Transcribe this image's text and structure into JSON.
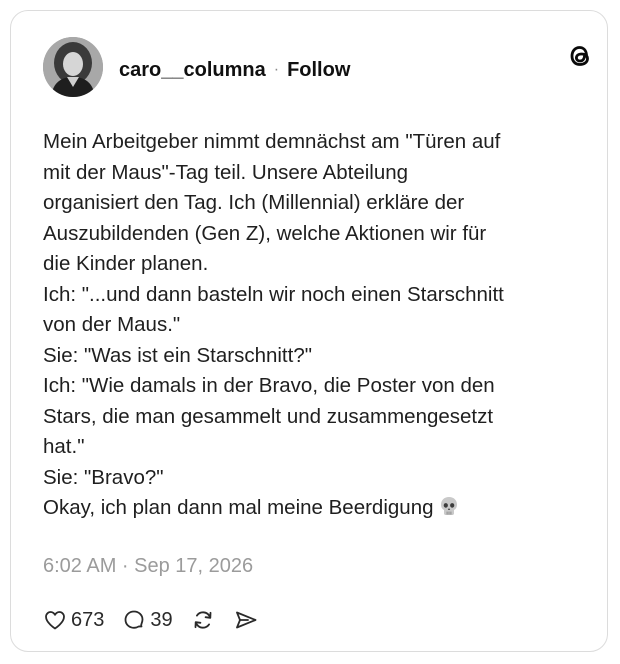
{
  "post": {
    "username": "caro__columna",
    "separator": "·",
    "follow_label": "Follow",
    "lines": [
      "Mein Arbeitgeber nimmt demnächst am \"Türen auf",
      "mit der Maus\"-Tag teil. Unsere Abteilung",
      "organisiert den Tag. Ich (Millennial) erkläre der",
      "Auszubildenden (Gen Z), welche Aktionen wir für",
      "die Kinder planen.",
      "Ich: \"...und dann basteln wir noch einen Starschnitt",
      "von der Maus.\"",
      "Sie: \"Was ist ein Starschnitt?\"",
      "Ich: \"Wie damals in der Bravo, die Poster von den",
      "Stars, die man gesammelt und zusammengesetzt",
      "hat.\"",
      "Sie: \"Bravo?\"",
      "Okay, ich plan dann mal meine Beerdigung"
    ],
    "end_emoji": "skull-icon",
    "timestamp": "6:02 AM · Sep 17, 2026"
  },
  "actions": {
    "likes": "673",
    "replies": "39"
  },
  "icons": {
    "logo": "threads-logo-icon",
    "like": "heart-icon",
    "reply": "comment-icon",
    "repost": "repost-icon",
    "share": "share-icon"
  },
  "colors": {
    "text": "#1f1f1f",
    "muted": "#9b9b9b",
    "border": "#dcdcdc",
    "background": "#ffffff"
  }
}
